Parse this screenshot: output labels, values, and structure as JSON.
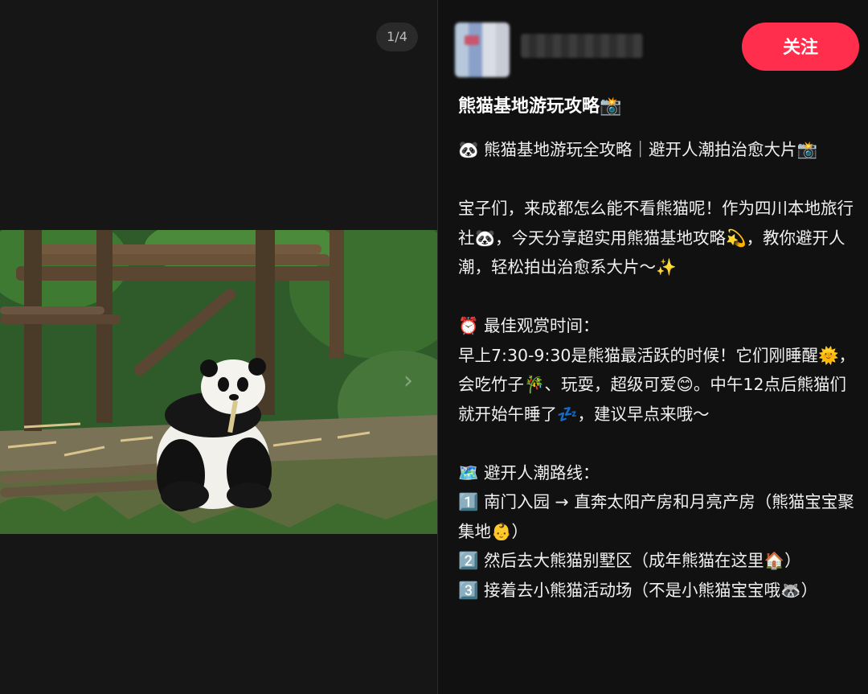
{
  "media": {
    "page_counter": "1/4",
    "next_icon": "chevron-right-icon"
  },
  "author": {
    "follow_label": "关注"
  },
  "post": {
    "title": "熊猫基地游玩攻略📸",
    "body": "🐼 熊猫基地游玩全攻略｜避开人潮拍治愈大片📸\n\n宝子们，来成都怎么能不看熊猫呢！作为四川本地旅行社🐼，今天分享超实用熊猫基地攻略💫，教你避开人潮，轻松拍出治愈系大片～✨\n\n⏰ 最佳观赏时间：\n早上7:30-9:30是熊猫最活跃的时候！它们刚睡醒🌞，会吃竹子🎋、玩耍，超级可爱😊。中午12点后熊猫们就开始午睡了💤，建议早点来哦～\n\n🗺️ 避开人潮路线：\n1️⃣ 南门入园 → 直奔太阳产房和月亮产房（熊猫宝宝聚集地👶）\n2️⃣ 然后去大熊猫别墅区（成年熊猫在这里🏠）\n3️⃣ 接着去小熊猫活动场（不是小熊猫宝宝哦🦝）"
  }
}
